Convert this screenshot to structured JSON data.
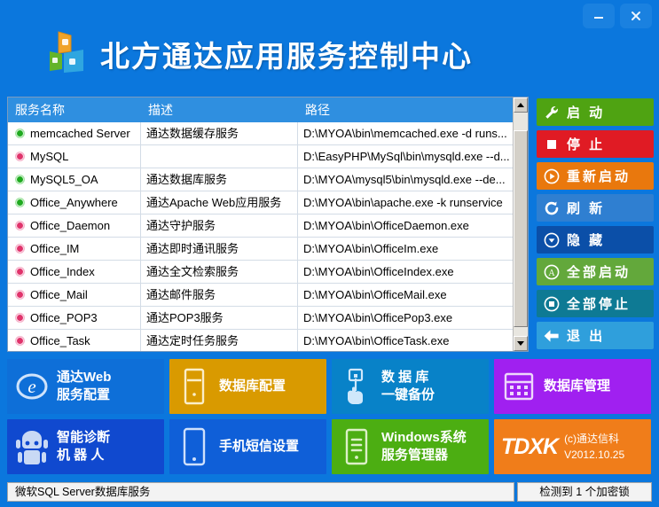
{
  "window": {
    "title": "北方通达应用服务控制中心",
    "logo_icon": "office-cubes-logo",
    "controls": [
      {
        "name": "minimize-button",
        "icon": "minimize-icon"
      },
      {
        "name": "close-button",
        "icon": "close-icon"
      }
    ],
    "titlebar_color": "#0b77dd"
  },
  "service_list": {
    "columns": [
      "服务名称",
      "描述",
      "路径"
    ],
    "rows": [
      {
        "status": "running",
        "name": "memcached Server",
        "desc": "通达数据缓存服务",
        "path": "D:\\MYOA\\bin\\memcached.exe -d runs..."
      },
      {
        "status": "stopped",
        "name": "MySQL",
        "desc": "",
        "path": "D:\\EasyPHP\\MySql\\bin\\mysqld.exe --d..."
      },
      {
        "status": "running",
        "name": "MySQL5_OA",
        "desc": "通达数据库服务",
        "path": "D:\\MYOA\\mysql5\\bin\\mysqld.exe --de..."
      },
      {
        "status": "running",
        "name": "Office_Anywhere",
        "desc": "通达Apache Web应用服务",
        "path": "D:\\MYOA\\bin\\apache.exe -k runservice"
      },
      {
        "status": "stopped",
        "name": "Office_Daemon",
        "desc": "通达守护服务",
        "path": "D:\\MYOA\\bin\\OfficeDaemon.exe"
      },
      {
        "status": "stopped",
        "name": "Office_IM",
        "desc": "通达即时通讯服务",
        "path": "D:\\MYOA\\bin\\OfficeIm.exe"
      },
      {
        "status": "stopped",
        "name": "Office_Index",
        "desc": "通达全文检索服务",
        "path": "D:\\MYOA\\bin\\OfficeIndex.exe"
      },
      {
        "status": "stopped",
        "name": "Office_Mail",
        "desc": "通达邮件服务",
        "path": "D:\\MYOA\\bin\\OfficeMail.exe"
      },
      {
        "status": "stopped",
        "name": "Office_POP3",
        "desc": "通达POP3服务",
        "path": "D:\\MYOA\\bin\\OfficePop3.exe"
      },
      {
        "status": "stopped",
        "name": "Office_Task",
        "desc": "通达定时任务服务",
        "path": "D:\\MYOA\\bin\\OfficeTask.exe"
      }
    ],
    "header_color": "#2f8fe0",
    "running_color": "#1faa1f",
    "stopped_color": "#e0336b"
  },
  "actions": [
    {
      "label": "启 动",
      "icon": "wrench-icon",
      "color": "#4fa312"
    },
    {
      "label": "停 止",
      "icon": "stop-square-icon",
      "color": "#e01b24"
    },
    {
      "label": "重新启动",
      "icon": "restart-circle-icon",
      "color": "#e9780d"
    },
    {
      "label": "刷 新",
      "icon": "refresh-icon",
      "color": "#2f7fd1"
    },
    {
      "label": "隐 藏",
      "icon": "hide-down-icon",
      "color": "#0b4fa8"
    },
    {
      "label": "全部启动",
      "icon": "circle-a-icon",
      "color": "#63a83b"
    },
    {
      "label": "全部停止",
      "icon": "circle-stop-icon",
      "color": "#0e7a94"
    },
    {
      "label": "退 出",
      "icon": "arrow-left-icon",
      "color": "#2f9fdc"
    }
  ],
  "tiles": [
    {
      "text": "通达Web\n服务配置",
      "icon": "e-logo-icon",
      "color": "#0e6fd8",
      "spaced": false
    },
    {
      "text": "数据库配置",
      "icon": "db-server-icon",
      "color": "#d99a00",
      "spaced": false
    },
    {
      "text": "数 据 库\n一键备份",
      "icon": "click-hand-icon",
      "color": "#0882c8",
      "spaced": false
    },
    {
      "text": "数据库管理",
      "icon": "db-grid-icon",
      "color": "#a020f0",
      "spaced": false
    },
    {
      "text": "智能诊断\n机 器 人",
      "icon": "robot-icon",
      "color": "#1049cf",
      "spaced": false
    },
    {
      "text": "手机短信设置",
      "icon": "smartphone-icon",
      "color": "#0f5fd8",
      "spaced": false
    },
    {
      "text": "Windows系统\n服务管理器",
      "icon": "server-lines-icon",
      "color": "#4cae12",
      "spaced": false
    }
  ],
  "brand_tile": {
    "wordmark": "TDXK",
    "meta": "(c)通达信科\nV2012.10.25",
    "color": "#f07d1a"
  },
  "statusbar": {
    "message": "微软SQL Server数据库服务",
    "dongle": "检测到 1 个加密锁"
  }
}
